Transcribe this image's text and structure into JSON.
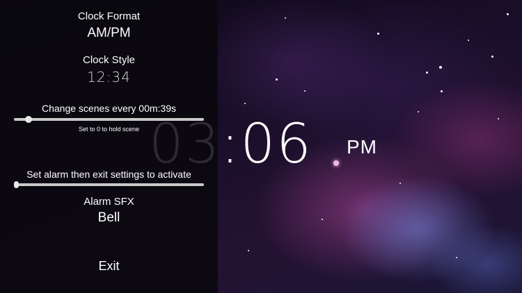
{
  "settings": {
    "clock_format_label": "Clock Format",
    "clock_format_value": "AM/PM",
    "clock_style_label": "Clock Style",
    "clock_style_value": "12:34",
    "scene_label": "Change scenes every 00m:39s",
    "scene_hint": "Set to 0 to hold scene",
    "scene_slider_level": 0.06,
    "alarm_label": "Set alarm then exit settings to activate",
    "alarm_slider_level": 0.0,
    "alarm_sfx_label": "Alarm SFX",
    "alarm_sfx_value": "Bell",
    "exit_label": "Exit"
  },
  "clock": {
    "hours": "03",
    "separator": ":",
    "minutes": "06",
    "period": "PM"
  },
  "colors": {
    "panel": "#0a080e",
    "text": "#ffffff",
    "slider_track": "#c9c9c9"
  }
}
